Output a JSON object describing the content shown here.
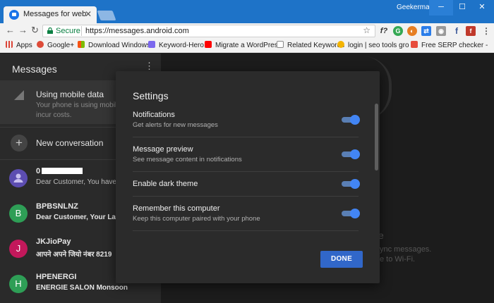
{
  "browser": {
    "tab_title": "Messages for web",
    "tab_close": "✕",
    "profile_name": "Geekermag",
    "secure_label": "Secure",
    "url": "https://messages.android.com",
    "window_controls": {
      "minimize": "─",
      "maximize": "☐",
      "close": "✕"
    }
  },
  "bookmarks": [
    {
      "label": "Apps",
      "color": "#db4437"
    },
    {
      "label": "Google+",
      "color": "#dd4b39"
    },
    {
      "label": "Download Windows",
      "color": "#f65314"
    },
    {
      "label": "Keyword-Hero",
      "color": "#7b68ee"
    },
    {
      "label": "Migrate a WordPress",
      "color": "#ff0000"
    },
    {
      "label": "Related Keywords",
      "color": "#888888"
    },
    {
      "label": "login | seo tools gro",
      "color": "#f4b400"
    },
    {
      "label": "Free SERP checker -",
      "color": "#e74c3c"
    }
  ],
  "sidebar": {
    "title": "Messages",
    "menu_icon": "⋮",
    "mobile_data": {
      "title": "Using mobile data",
      "subtitle": "Your phone is using mobile which may incur costs."
    },
    "new_conversation": "New conversation",
    "conversations": [
      {
        "name": "0",
        "snippet": "Dear Customer, You have a",
        "initial": "",
        "color": "#5c4db1",
        "redacted": true
      },
      {
        "name": "BPBSNLNZ",
        "snippet": "Dear Customer, Your Landli",
        "initial": "B",
        "color": "#2e9e56"
      },
      {
        "name": "JKJioPay",
        "snippet": "आपने अपने जियो नंबर 8219",
        "initial": "J",
        "color": "#c2185b"
      },
      {
        "name": "HPENERGI",
        "snippet": "ENERGIE SALON Monsoon",
        "initial": "H",
        "color": "#2e9e56"
      }
    ]
  },
  "background_text": {
    "fragment_1": "e",
    "fragment_2": "ync messages.",
    "fragment_3": "e to Wi-Fi."
  },
  "dialog": {
    "title": "Settings",
    "settings": [
      {
        "title": "Notifications",
        "subtitle": "Get alerts for new messages",
        "enabled": true
      },
      {
        "title": "Message preview",
        "subtitle": "See message content in notifications",
        "enabled": true
      },
      {
        "title": "Enable dark theme",
        "subtitle": "",
        "enabled": true
      },
      {
        "title": "Remember this computer",
        "subtitle": "Keep this computer paired with your phone",
        "enabled": true
      }
    ],
    "done_label": "DONE"
  },
  "colors": {
    "titlebar": "#1e73c8",
    "accent": "#4285f4",
    "done_button": "#3167c9"
  }
}
